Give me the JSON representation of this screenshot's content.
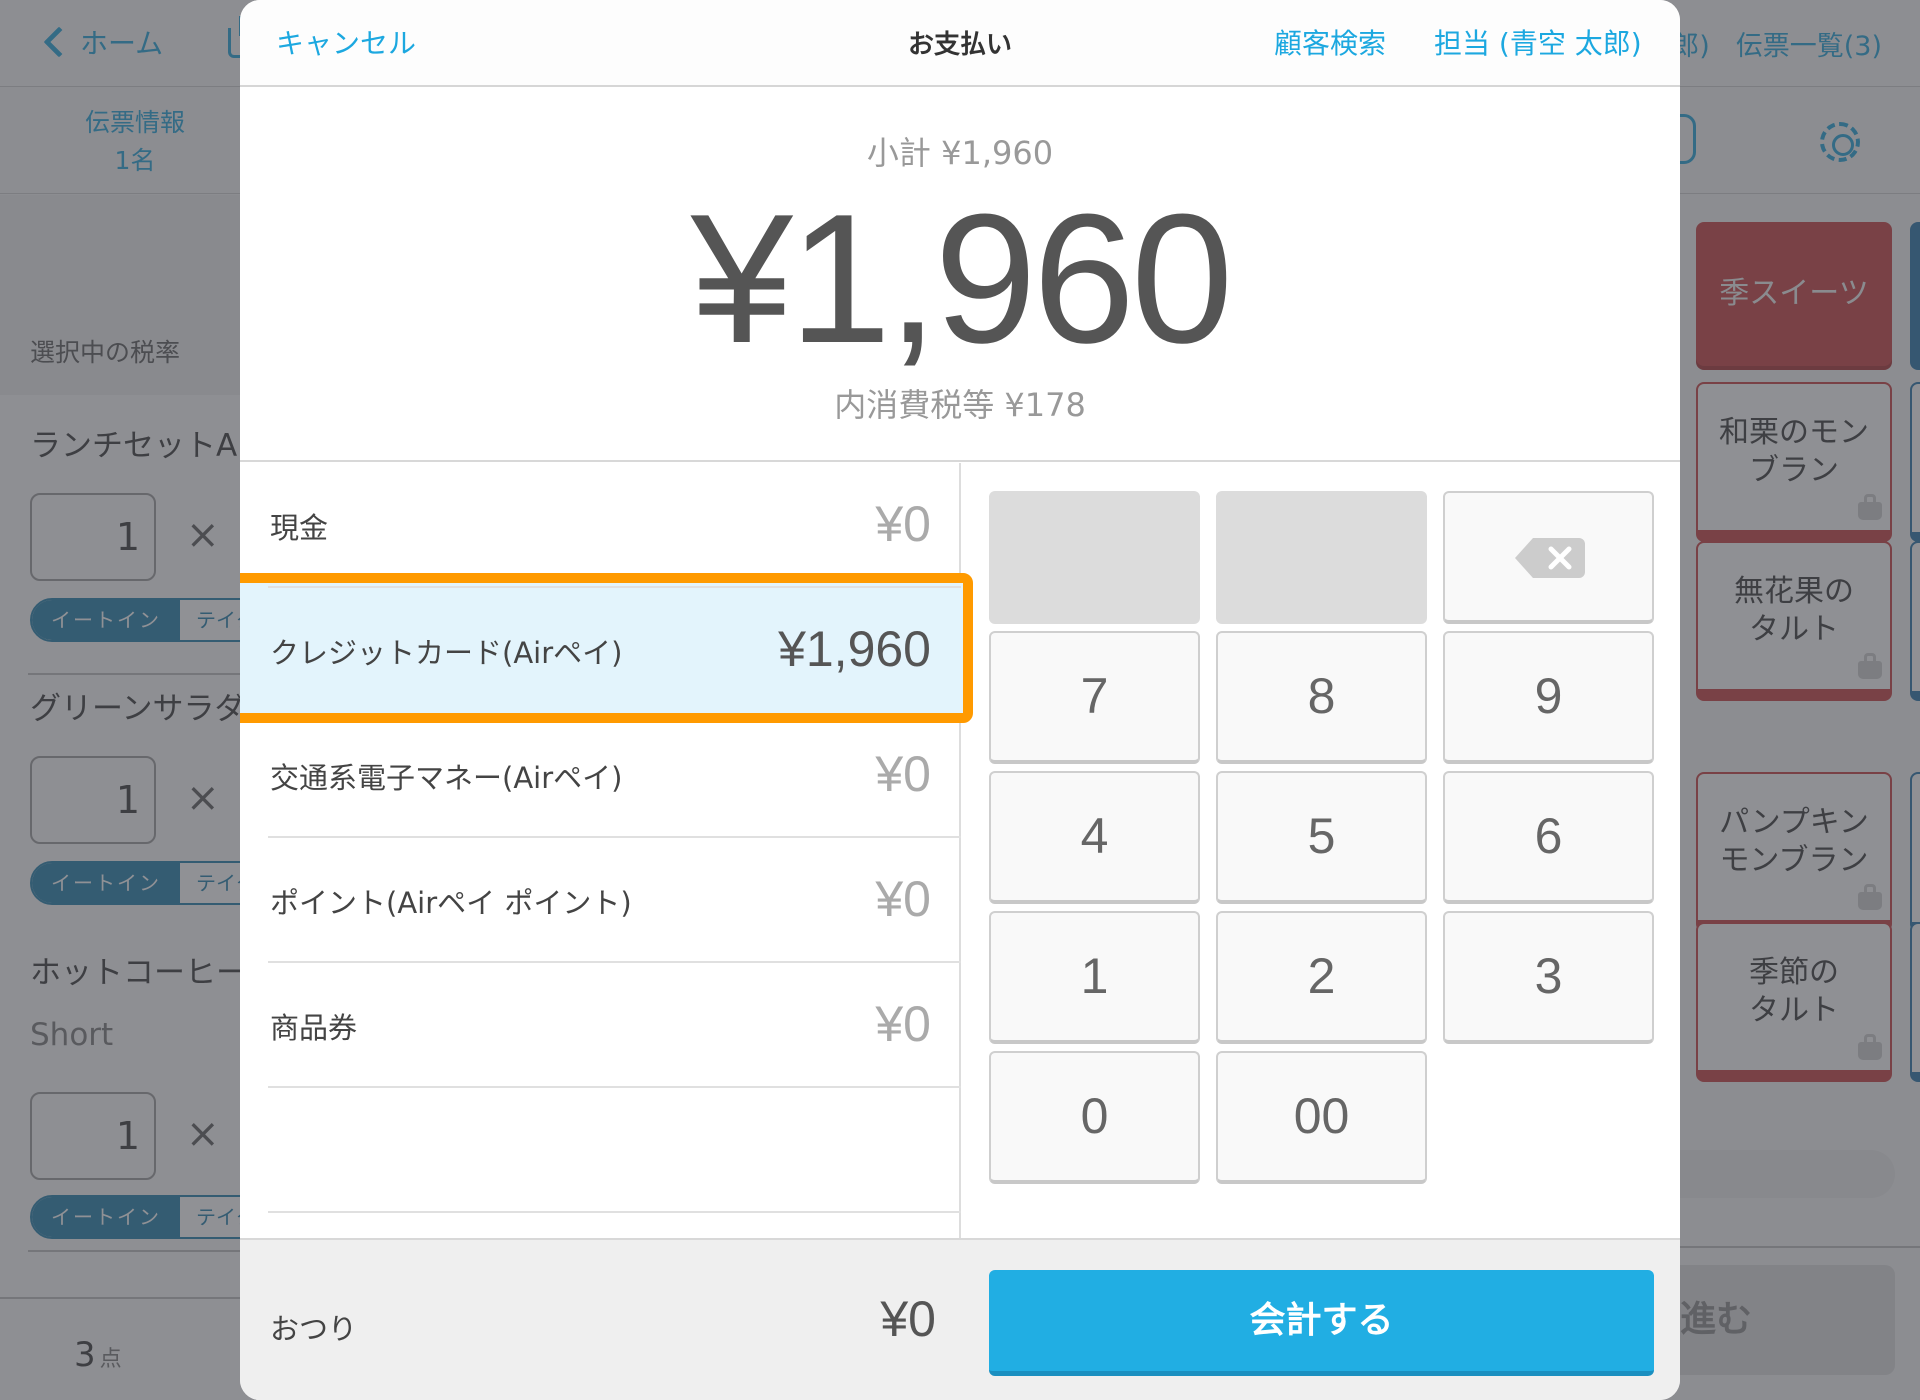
{
  "background": {
    "topbar": {
      "back_label": "ホーム",
      "right_items": [
        "郎)",
        "伝票一覧(3)"
      ]
    },
    "subbar": {
      "slip_info_title": "伝票情報",
      "slip_info_guests": "1名"
    },
    "tax_rate_label": "選択中の税率",
    "order_items": [
      {
        "name": "ランチセットA",
        "variant": "",
        "qty": "1",
        "times": "×",
        "eat_in": "イートイン",
        "take_out": "テイクアウト"
      },
      {
        "name": "グリーンサラダ",
        "variant": "",
        "qty": "1",
        "times": "×",
        "eat_in": "イートイン",
        "take_out": "テイクアウト"
      },
      {
        "name": "ホットコーヒー",
        "variant": "Short",
        "qty": "1",
        "times": "×",
        "eat_in": "イートイン",
        "take_out": "テイクアウト"
      }
    ],
    "item_count": "3",
    "item_count_unit": "点",
    "category_tile": "季スイーツ",
    "product_tiles": [
      "和栗のモン\nブラン",
      "無花果の\nタルト",
      "パンプキン\nモンブラン",
      "季節の\nタルト"
    ],
    "next_button": "進む",
    "colors": {
      "category_red": "#c6383a",
      "category_blue": "#1e6ea5",
      "accent": "#1aa0d8"
    }
  },
  "modal": {
    "cancel_label": "キャンセル",
    "title": "お支払い",
    "customer_search_label": "顧客検索",
    "staff_label": "担当 (青空 太郎)",
    "subtotal": "小計 ¥1,960",
    "total": "¥1,960",
    "tax_included": "内消費税等 ¥178",
    "payment_methods": [
      {
        "label": "現金",
        "amount": "¥0",
        "selected": false
      },
      {
        "label": "クレジットカード(Airペイ)",
        "amount": "¥1,960",
        "selected": true
      },
      {
        "label": "交通系電子マネー(Airペイ)",
        "amount": "¥0",
        "selected": false
      },
      {
        "label": "ポイント(Airペイ ポイント)",
        "amount": "¥0",
        "selected": false
      },
      {
        "label": "商品券",
        "amount": "¥0",
        "selected": false
      }
    ],
    "keypad": {
      "keys": [
        "7",
        "8",
        "9",
        "4",
        "5",
        "6",
        "1",
        "2",
        "3",
        "0",
        "00"
      ],
      "backspace_icon": "backspace-icon"
    },
    "change_label": "おつり",
    "change_value": "¥0",
    "checkout_label": "会計する",
    "colors": {
      "link": "#1ca8e0",
      "highlight_border": "#ff9a00",
      "selected_row": "#e3f4fc",
      "checkout": "#21aee3"
    }
  }
}
